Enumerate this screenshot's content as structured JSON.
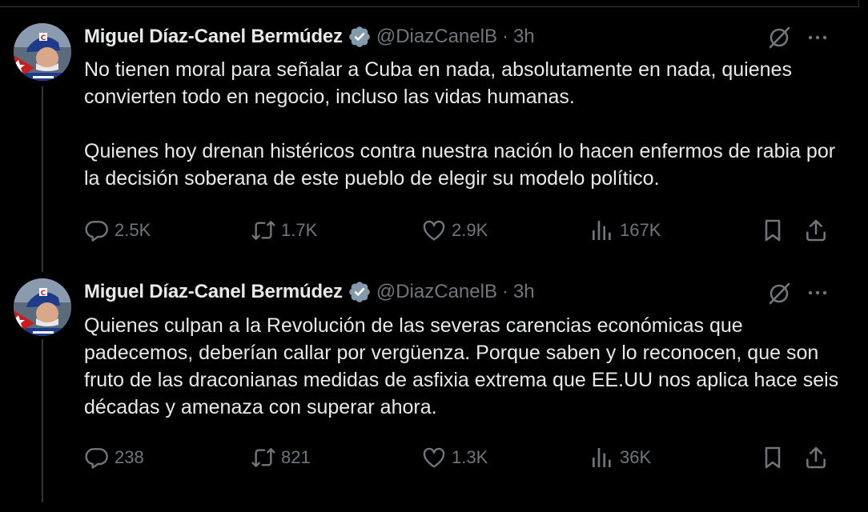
{
  "tweets": [
    {
      "author": {
        "display_name": "Miguel Díaz-Canel Bermúdez",
        "handle": "@DiazCanelB",
        "time": "3h",
        "separator": "·",
        "verified": true
      },
      "text": "No tienen moral para señalar a Cuba en nada, absolutamente en nada, quienes convierten todo en negocio, incluso las vidas humanas.\n\nQuienes hoy drenan histéricos contra nuestra nación lo hacen enfermos de rabia por la decisión soberana de este pueblo de elegir su modelo político.",
      "stats": {
        "replies": "2.5K",
        "reposts": "1.7K",
        "likes": "2.9K",
        "views": "167K"
      }
    },
    {
      "author": {
        "display_name": "Miguel Díaz-Canel Bermúdez",
        "handle": "@DiazCanelB",
        "time": "3h",
        "separator": "·",
        "verified": true
      },
      "text": "Quienes culpan a la Revolución de las severas carencias económicas que padecemos, deberían callar por vergüenza. Porque saben y lo reconocen, que son fruto de las draconianas medidas de asfixia extrema que EE.UU nos aplica hace seis décadas y amenaza con superar ahora.",
      "stats": {
        "replies": "238",
        "reposts": "821",
        "likes": "1.3K",
        "views": "36K"
      }
    }
  ],
  "icons": {
    "verified": "verified-badge-icon",
    "grok": "grok-icon",
    "more": "more-icon",
    "reply": "reply-icon",
    "repost": "repost-icon",
    "like": "like-icon",
    "views": "views-icon",
    "bookmark": "bookmark-icon",
    "share": "share-icon"
  },
  "colors": {
    "background": "#000000",
    "text": "#e7e9ea",
    "muted": "#71767b",
    "thread_line": "#333639",
    "verified_badge": "#829aab"
  }
}
